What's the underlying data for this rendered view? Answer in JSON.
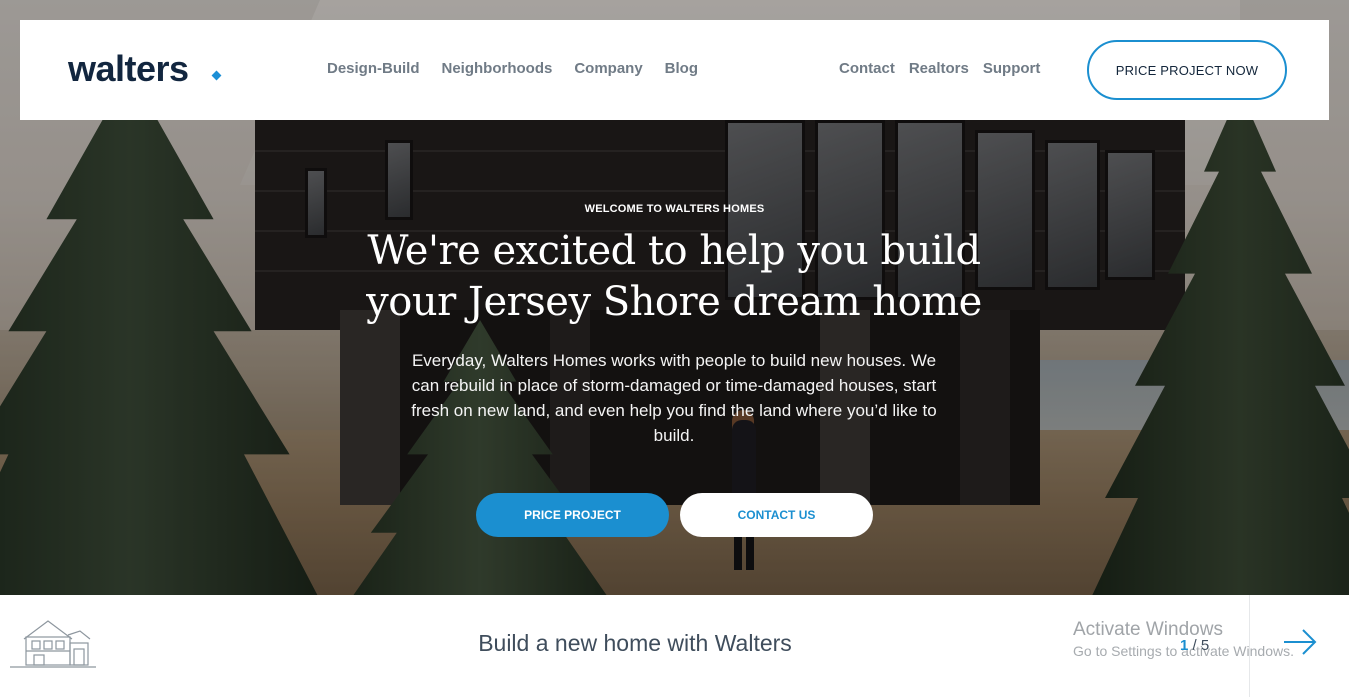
{
  "header": {
    "logo_text": "walters",
    "nav_left": [
      "Design-Build",
      "Neighborhoods",
      "Company",
      "Blog"
    ],
    "nav_right": [
      "Contact",
      "Realtors",
      "Support"
    ],
    "cta_label": "PRICE PROJECT NOW"
  },
  "hero": {
    "eyebrow": "WELCOME TO WALTERS HOMES",
    "headline": "We're excited to help you build your Jersey Shore dream home",
    "lead": "Everyday, Walters Homes works with people to build new houses. We can rebuild in place of storm-damaged or time-damaged houses, start fresh on new land, and even help you find the land where you’d like to build.",
    "primary_button": "PRICE PROJECT",
    "secondary_button": "CONTACT US"
  },
  "slider": {
    "title": "Build a new home with Walters",
    "current": "1",
    "separator": "/",
    "total": "5",
    "icon": "house-outline-icon",
    "next_icon": "arrow-right-icon"
  },
  "os_watermark": {
    "title": "Activate Windows",
    "subtitle": "Go to Settings to activate Windows."
  },
  "colors": {
    "brand_blue": "#1b8fd0",
    "navy": "#12263f",
    "nav_text": "#707b86"
  }
}
